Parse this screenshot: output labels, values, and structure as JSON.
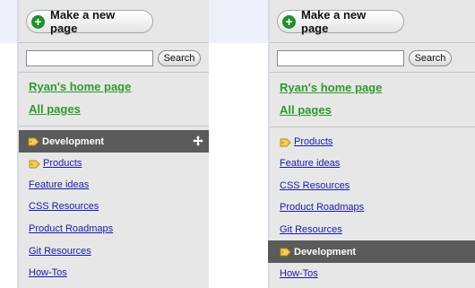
{
  "left_panel": {
    "new_page_label": "Make a new page",
    "search": {
      "value": "",
      "button_label": "Search"
    },
    "home_link": "Ryan's home page",
    "all_pages_link": "All pages",
    "selected_item": "Development",
    "items": [
      "Products",
      "Feature ideas",
      "CSS Resources",
      "Product Roadmaps",
      "Git Resources",
      "How-Tos"
    ]
  },
  "right_panel": {
    "new_page_label": "Make a new page",
    "search": {
      "value": "",
      "button_label": "Search"
    },
    "home_link": "Ryan's home page",
    "all_pages_link": "All pages",
    "items": [
      "Products",
      "Feature ideas",
      "CSS Resources",
      "Product Roadmaps",
      "Git Resources"
    ],
    "selected_item": "Development",
    "last_item": "How-Tos"
  },
  "colors": {
    "link_green": "#2e9a2e",
    "link_blue": "#1a1aa6",
    "selected_bg": "#5b5b5b",
    "panel_bg": "#e7e7e7"
  }
}
